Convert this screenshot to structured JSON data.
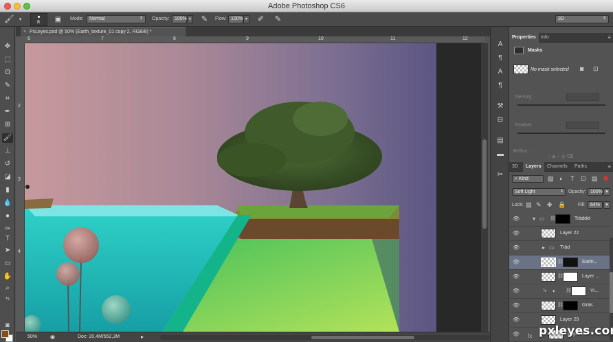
{
  "window": {
    "title": "Adobe Photoshop CS6",
    "workspace": "3D"
  },
  "options_bar": {
    "brush_size": "8",
    "mode_label": "Mode:",
    "mode_value": "Normal",
    "opacity_label": "Opacity:",
    "opacity_value": "100%",
    "flow_label": "Flow:",
    "flow_value": "100%"
  },
  "document": {
    "tab_title": "PxLeyes.psd @ 50% (Earth_texture_01 copy 2, RGB/8) *",
    "ruler_h_ticks": [
      "6",
      "7",
      "8",
      "9",
      "10",
      "11",
      "12"
    ],
    "ruler_v_ticks": [
      "2",
      "3",
      "4"
    ],
    "zoom": "50%",
    "doc_size": "Doc: 20,4M/552,3M"
  },
  "tools": [
    "move-icon",
    "marquee-icon",
    "lasso-icon",
    "quick-select-icon",
    "crop-icon",
    "eyedropper-icon",
    "healing-icon",
    "brush-icon",
    "stamp-icon",
    "history-brush-icon",
    "eraser-icon",
    "gradient-icon",
    "blur-icon",
    "dodge-icon",
    "pen-icon",
    "type-icon",
    "path-select-icon",
    "shape-icon",
    "hand-icon",
    "zoom-icon"
  ],
  "colors": {
    "foreground": "#8a4b16",
    "background": "#ffffff",
    "selection": "#6a7385"
  },
  "properties_panel": {
    "tabs": [
      "Properties",
      "Info"
    ],
    "active_tab": "Properties",
    "section": "Masks",
    "mask_status": "No mask selected",
    "density_label": "Density:",
    "feather_label": "Feather:",
    "refine_label": "Refine:"
  },
  "layers_panel": {
    "tabs": [
      "3D",
      "Layers",
      "Channels",
      "Paths"
    ],
    "active_tab": "Layers",
    "filter_kind": "Kind",
    "blend_mode": "Soft Light",
    "opacity_label": "Opacity:",
    "opacity_value": "100%",
    "lock_label": "Lock:",
    "fill_label": "Fill:",
    "fill_value": "64%",
    "layers": [
      {
        "name": "Träddel",
        "type": "group-open",
        "mask": "dark"
      },
      {
        "name": "Layer 22",
        "type": "layer"
      },
      {
        "name": "Träd",
        "type": "group-closed"
      },
      {
        "name": "Earth...",
        "type": "layer",
        "mask": "dark",
        "selected": true
      },
      {
        "name": "Layer ...",
        "type": "layer",
        "mask": "white"
      },
      {
        "name": "Vi...",
        "type": "adjustment",
        "mask": "white",
        "clipped": true
      },
      {
        "name": "Gräs.",
        "type": "layer",
        "mask": "black"
      },
      {
        "name": "Layer 29",
        "type": "layer"
      },
      {
        "name": "Layer 30",
        "type": "layer",
        "clipped": true
      }
    ]
  },
  "watermark": "pxleyes.com"
}
